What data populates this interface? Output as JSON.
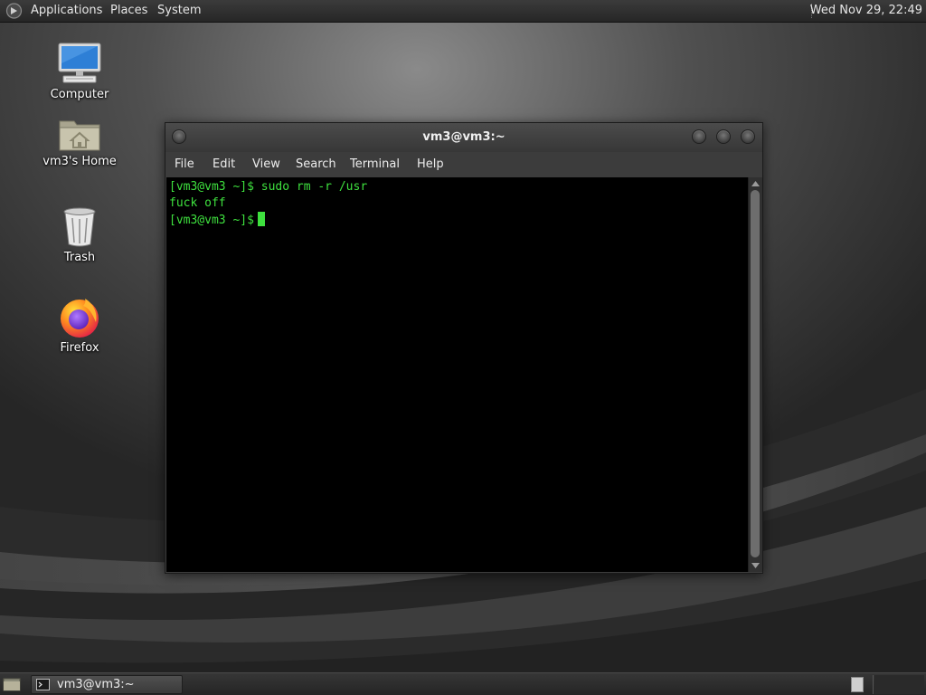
{
  "top_panel": {
    "applications": "Applications",
    "places": "Places",
    "system": "System",
    "clock": "Wed Nov 29, 22:49"
  },
  "desktop": {
    "icons": [
      {
        "label": "Computer",
        "icon": "computer-icon"
      },
      {
        "label": "vm3's Home",
        "icon": "home-folder-icon"
      },
      {
        "label": "Trash",
        "icon": "trash-icon"
      },
      {
        "label": "Firefox",
        "icon": "firefox-icon"
      }
    ]
  },
  "terminal": {
    "title": "vm3@vm3:~",
    "menu": [
      "File",
      "Edit",
      "View",
      "Search",
      "Terminal",
      "Help"
    ],
    "lines": [
      "[vm3@vm3 ~]$ sudo rm -r /usr",
      "fuck off",
      "[vm3@vm3 ~]$"
    ],
    "text_color": "#3ee03e",
    "background": "#000000"
  },
  "bottom_panel": {
    "task": "vm3@vm3:~"
  }
}
